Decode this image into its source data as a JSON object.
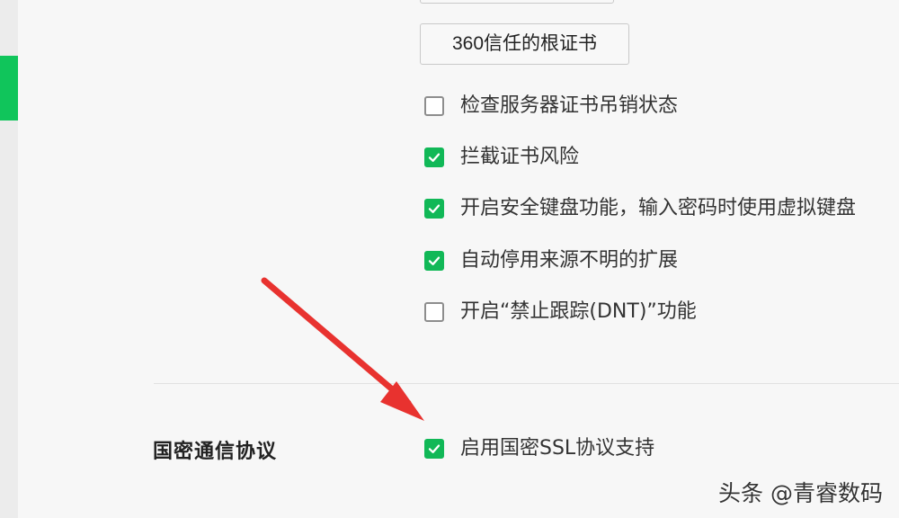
{
  "buttons": {
    "top_label": "",
    "root_cert_label": "360信任的根证书"
  },
  "options": [
    {
      "label": "检查服务器证书吊销状态",
      "checked": false
    },
    {
      "label": "拦截证书风险",
      "checked": true
    },
    {
      "label": "开启安全键盘功能，输入密码时使用虚拟键盘",
      "checked": true
    },
    {
      "label": "自动停用来源不明的扩展",
      "checked": true
    },
    {
      "label": "开启“禁止跟踪(DNT)”功能",
      "checked": false
    }
  ],
  "section": {
    "title": "国密通信协议",
    "option": {
      "label": "启用国密SSL协议支持",
      "checked": true
    }
  },
  "watermark": "头条 @青睿数码",
  "colors": {
    "accent": "#11b857",
    "sidebar_active": "#10c55b",
    "arrow": "#e8322f"
  },
  "icons": {
    "checked": "check-icon",
    "annotation": "red-arrow"
  }
}
